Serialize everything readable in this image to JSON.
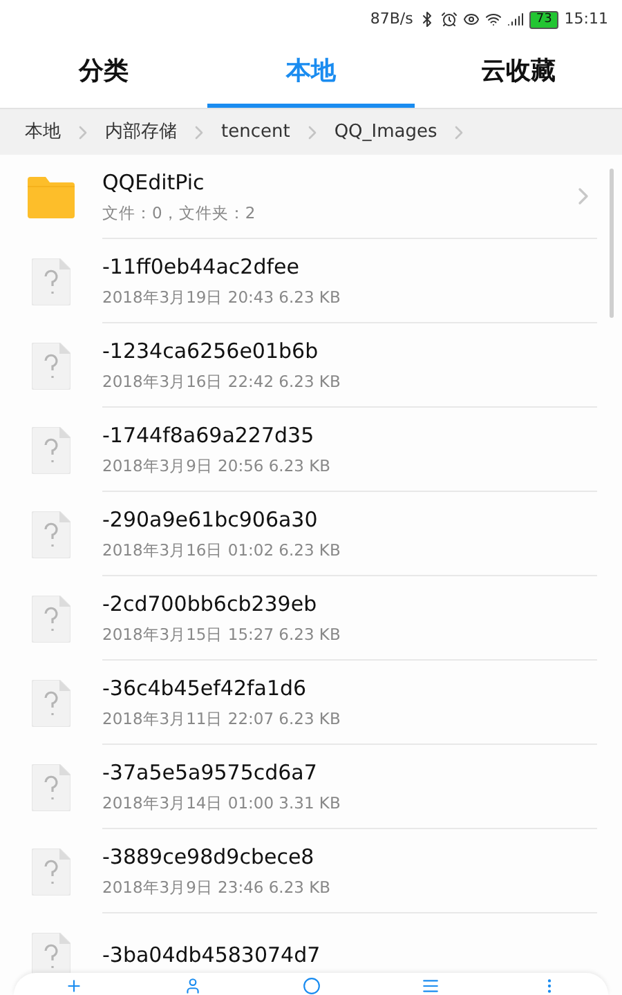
{
  "status_bar": {
    "speed": "87B/s",
    "battery": "73",
    "time": "15:11"
  },
  "tabs": [
    {
      "label": "分类",
      "selected": false
    },
    {
      "label": "本地",
      "selected": true
    },
    {
      "label": "云收藏",
      "selected": false
    }
  ],
  "breadcrumb": [
    "本地",
    "内部存储",
    "tencent",
    "QQ_Images"
  ],
  "items": [
    {
      "kind": "folder",
      "name": "QQEditPic",
      "meta": "文件：0，文件夹：2"
    },
    {
      "kind": "file",
      "name": "-11ff0eb44ac2dfee",
      "meta": "2018年3月19日 20:43 6.23 KB"
    },
    {
      "kind": "file",
      "name": "-1234ca6256e01b6b",
      "meta": "2018年3月16日 22:42 6.23 KB"
    },
    {
      "kind": "file",
      "name": "-1744f8a69a227d35",
      "meta": "2018年3月9日 20:56 6.23 KB"
    },
    {
      "kind": "file",
      "name": "-290a9e61bc906a30",
      "meta": "2018年3月16日 01:02 6.23 KB"
    },
    {
      "kind": "file",
      "name": "-2cd700bb6cb239eb",
      "meta": "2018年3月15日 15:27 6.23 KB"
    },
    {
      "kind": "file",
      "name": "-36c4b45ef42fa1d6",
      "meta": "2018年3月11日 22:07 6.23 KB"
    },
    {
      "kind": "file",
      "name": "-37a5e5a9575cd6a7",
      "meta": "2018年3月14日 01:00 3.31 KB"
    },
    {
      "kind": "file",
      "name": "-3889ce98d9cbece8",
      "meta": "2018年3月9日 23:46 6.23 KB"
    },
    {
      "kind": "file",
      "name": "-3ba04db4583074d7"
    }
  ]
}
